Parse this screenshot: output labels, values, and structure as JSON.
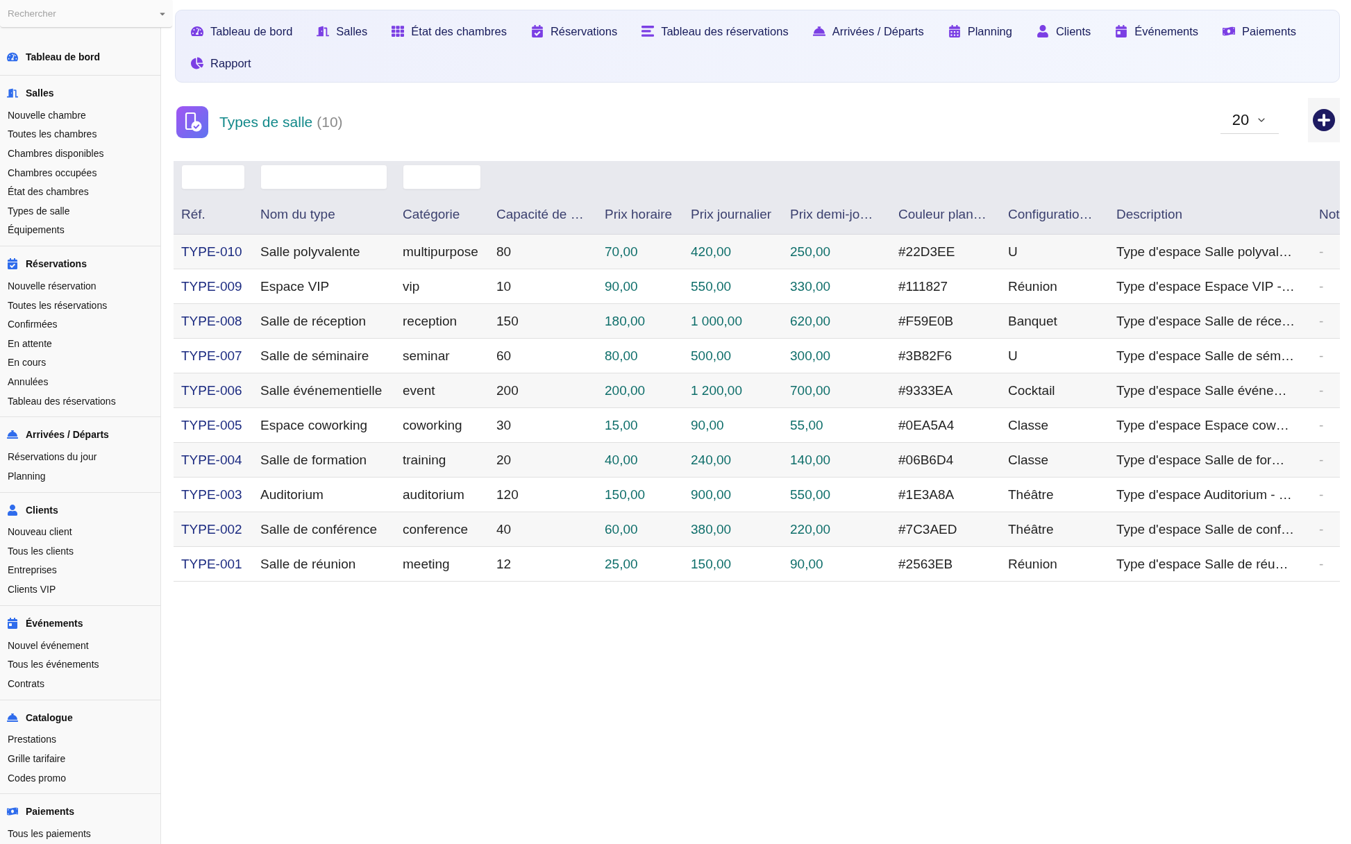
{
  "sidebar": {
    "search": {
      "placeholder": "Rechercher"
    },
    "sections": [
      {
        "title": "Tableau de bord"
      },
      {
        "title": "Salles",
        "items": [
          "Nouvelle chambre",
          "Toutes les chambres",
          "Chambres disponibles",
          "Chambres occupées",
          "État des chambres",
          "Types de salle",
          "Équipements"
        ]
      },
      {
        "title": "Réservations",
        "items": [
          "Nouvelle réservation",
          "Toutes les réservations",
          "Confirmées",
          "En attente",
          "En cours",
          "Annulées",
          "Tableau des réservations"
        ]
      },
      {
        "title": "Arrivées / Départs",
        "items": [
          "Réservations du jour",
          "Planning"
        ]
      },
      {
        "title": "Clients",
        "items": [
          "Nouveau client",
          "Tous les clients",
          "Entreprises",
          "Clients VIP"
        ]
      },
      {
        "title": "Événements",
        "items": [
          "Nouvel événement",
          "Tous les événements",
          "Contrats"
        ]
      },
      {
        "title": "Catalogue",
        "items": [
          "Prestations",
          "Grille tarifaire",
          "Codes promo"
        ]
      },
      {
        "title": "Paiements",
        "items": [
          "Tous les paiements"
        ]
      }
    ]
  },
  "top_nav": {
    "items": [
      "Tableau de bord",
      "Salles",
      "État des chambres",
      "Réservations",
      "Tableau des réservations",
      "Arrivées / Départs",
      "Planning",
      "Clients",
      "Événements",
      "Paiements",
      "Rapport"
    ]
  },
  "page_header": {
    "title": "Types de salle",
    "count": "(10)",
    "page_size": "20"
  },
  "table": {
    "columns": [
      {
        "label": "Réf.",
        "kind": "ref",
        "filter": true
      },
      {
        "label": "Nom du type",
        "kind": "text",
        "filter": true
      },
      {
        "label": "Catégorie",
        "kind": "text",
        "filter": true
      },
      {
        "label": "Capacité de …",
        "kind": "text",
        "filter": false
      },
      {
        "label": "Prix horaire",
        "kind": "price",
        "filter": false
      },
      {
        "label": "Prix journalier",
        "kind": "price",
        "filter": false
      },
      {
        "label": "Prix demi-jo…",
        "kind": "price",
        "filter": false
      },
      {
        "label": "Couleur plan…",
        "kind": "text",
        "filter": false
      },
      {
        "label": "Configuratio…",
        "kind": "text",
        "filter": false
      },
      {
        "label": "Description",
        "kind": "text",
        "filter": false
      },
      {
        "label": "Not",
        "kind": "muted",
        "filter": false
      }
    ],
    "rows": [
      [
        "TYPE-010",
        "Salle polyvalente",
        "multipurpose",
        "80",
        "70,00",
        "420,00",
        "250,00",
        "#22D3EE",
        "U",
        "Type d'espace Salle polyval…",
        "-"
      ],
      [
        "TYPE-009",
        "Espace VIP",
        "vip",
        "10",
        "90,00",
        "550,00",
        "330,00",
        "#111827",
        "Réunion",
        "Type d'espace Espace VIP -…",
        "-"
      ],
      [
        "TYPE-008",
        "Salle de réception",
        "reception",
        "150",
        "180,00",
        "1 000,00",
        "620,00",
        "#F59E0B",
        "Banquet",
        "Type d'espace Salle de réce…",
        "-"
      ],
      [
        "TYPE-007",
        "Salle de séminaire",
        "seminar",
        "60",
        "80,00",
        "500,00",
        "300,00",
        "#3B82F6",
        "U",
        "Type d'espace Salle de sém…",
        "-"
      ],
      [
        "TYPE-006",
        "Salle événementielle",
        "event",
        "200",
        "200,00",
        "1 200,00",
        "700,00",
        "#9333EA",
        "Cocktail",
        "Type d'espace Salle événe…",
        "-"
      ],
      [
        "TYPE-005",
        "Espace coworking",
        "coworking",
        "30",
        "15,00",
        "90,00",
        "55,00",
        "#0EA5A4",
        "Classe",
        "Type d'espace Espace cow…",
        "-"
      ],
      [
        "TYPE-004",
        "Salle de formation",
        "training",
        "20",
        "40,00",
        "240,00",
        "140,00",
        "#06B6D4",
        "Classe",
        "Type d'espace Salle de for…",
        "-"
      ],
      [
        "TYPE-003",
        "Auditorium",
        "auditorium",
        "120",
        "150,00",
        "900,00",
        "550,00",
        "#1E3A8A",
        "Théâtre",
        "Type d'espace Auditorium - …",
        "-"
      ],
      [
        "TYPE-002",
        "Salle de conférence",
        "conference",
        "40",
        "60,00",
        "380,00",
        "220,00",
        "#7C3AED",
        "Théâtre",
        "Type d'espace Salle de conf…",
        "-"
      ],
      [
        "TYPE-001",
        "Salle de réunion",
        "meeting",
        "12",
        "25,00",
        "150,00",
        "90,00",
        "#2563EB",
        "Réunion",
        "Type d'espace Salle de réu…",
        "-"
      ]
    ]
  }
}
